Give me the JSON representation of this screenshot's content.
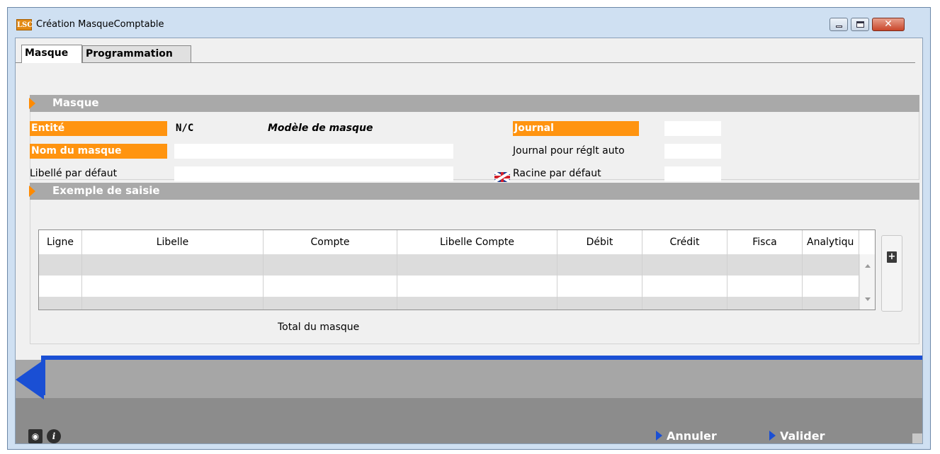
{
  "window": {
    "logo": "LSC",
    "title": "Création MasqueComptable",
    "controls": {
      "minimize_icon": "minimize-icon",
      "maximize_icon": "maximize-icon",
      "close_icon": "close-icon",
      "close_glyph": "✕"
    }
  },
  "tabs": [
    {
      "label": "Masque",
      "active": true
    },
    {
      "label": "Programmation",
      "active": false
    }
  ],
  "section_masque": {
    "title": "Masque",
    "entite_label": "Entité",
    "entite_value": "N/C",
    "modele_label": "Modèle de masque",
    "nom_label": "Nom du masque",
    "nom_value": "",
    "libelle_label": "Libellé par défaut",
    "libelle_value": "",
    "journal_label": "Journal",
    "journal_value": "",
    "journal_reglt_label": "Journal pour réglt auto",
    "journal_reglt_value": "",
    "racine_label": "Racine par défaut",
    "racine_value": "",
    "flag_icon": "uk-flag-icon"
  },
  "section_exemple": {
    "title": "Exemple de saisie",
    "columns": [
      "Ligne",
      "Libelle",
      "Compte",
      "Libelle Compte",
      "Débit",
      "Crédit",
      "Fisca",
      "Analytiqu"
    ],
    "rows": [
      [
        "",
        "",
        "",
        "",
        "",
        "",
        "",
        ""
      ],
      [
        "",
        "",
        "",
        "",
        "",
        "",
        "",
        ""
      ],
      [
        "",
        "",
        "",
        "",
        "",
        "",
        "",
        ""
      ]
    ],
    "total_label": "Total du masque",
    "add_icon": "add-document-icon"
  },
  "footer": {
    "users_icon": "users-icon",
    "info_icon": "info-icon",
    "info_glyph": "i",
    "cancel_label": "Annuler",
    "validate_label": "Valider"
  },
  "colors": {
    "accent_orange": "#ff9410",
    "section_grey": "#a9a9a9",
    "footer_blue": "#1a4fd4"
  }
}
